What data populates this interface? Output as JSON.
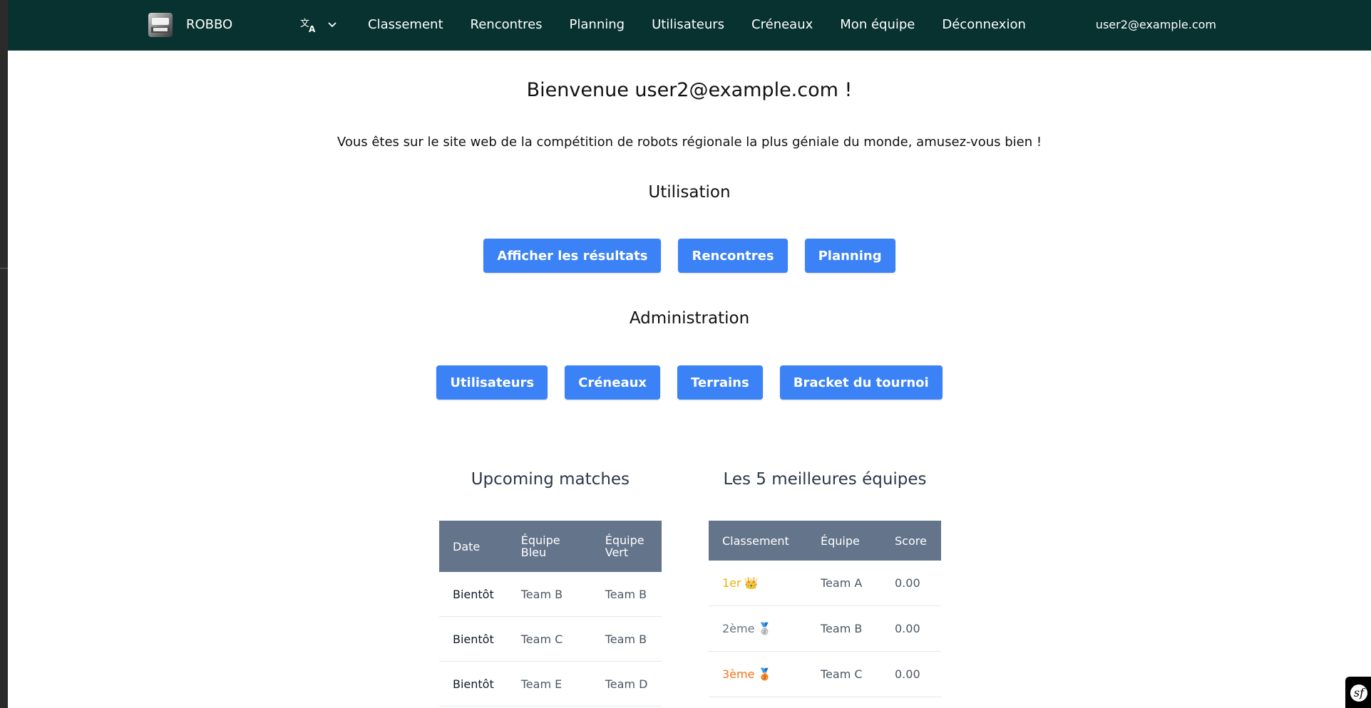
{
  "navbar": {
    "brand": "ROBBO",
    "links": [
      "Classement",
      "Rencontres",
      "Planning",
      "Utilisateurs",
      "Créneaux",
      "Mon équipe",
      "Déconnexion"
    ],
    "user_email": "user2@example.com",
    "language_icon": "translate-icon"
  },
  "main": {
    "welcome": "Bienvenue user2@example.com !",
    "intro": "Vous êtes sur le site web de la compétition de robots régionale la plus géniale du monde, amusez-vous bien !",
    "usage": {
      "heading": "Utilisation",
      "buttons": [
        "Afficher les résultats",
        "Rencontres",
        "Planning"
      ]
    },
    "admin": {
      "heading": "Administration",
      "buttons": [
        "Utilisateurs",
        "Créneaux",
        "Terrains",
        "Bracket du tournoi"
      ]
    }
  },
  "upcoming": {
    "title": "Upcoming matches",
    "headers": [
      "Date",
      "Équipe Bleu",
      "Équipe Vert"
    ],
    "rows": [
      [
        "Bientôt",
        "Team B",
        "Team B"
      ],
      [
        "Bientôt",
        "Team C",
        "Team B"
      ],
      [
        "Bientôt",
        "Team E",
        "Team D"
      ]
    ]
  },
  "top_teams": {
    "title": "Les 5 meilleures équipes",
    "headers": [
      "Classement",
      "Équipe",
      "Score"
    ],
    "rows": [
      {
        "rank": "1er",
        "medal": "👑",
        "team": "Team A",
        "score": "0.00"
      },
      {
        "rank": "2ème",
        "medal": "🥈",
        "team": "Team B",
        "score": "0.00"
      },
      {
        "rank": "3ème",
        "medal": "🥉",
        "team": "Team C",
        "score": "0.00"
      }
    ],
    "rank_colors": [
      "#eab308",
      "#6b7280",
      "#f97316"
    ]
  },
  "colors": {
    "navbar_bg": "#073230",
    "button_bg": "#3b82f6",
    "table_header_bg": "#64748b"
  },
  "symfony_toolbar": {
    "glyph": "sf"
  }
}
